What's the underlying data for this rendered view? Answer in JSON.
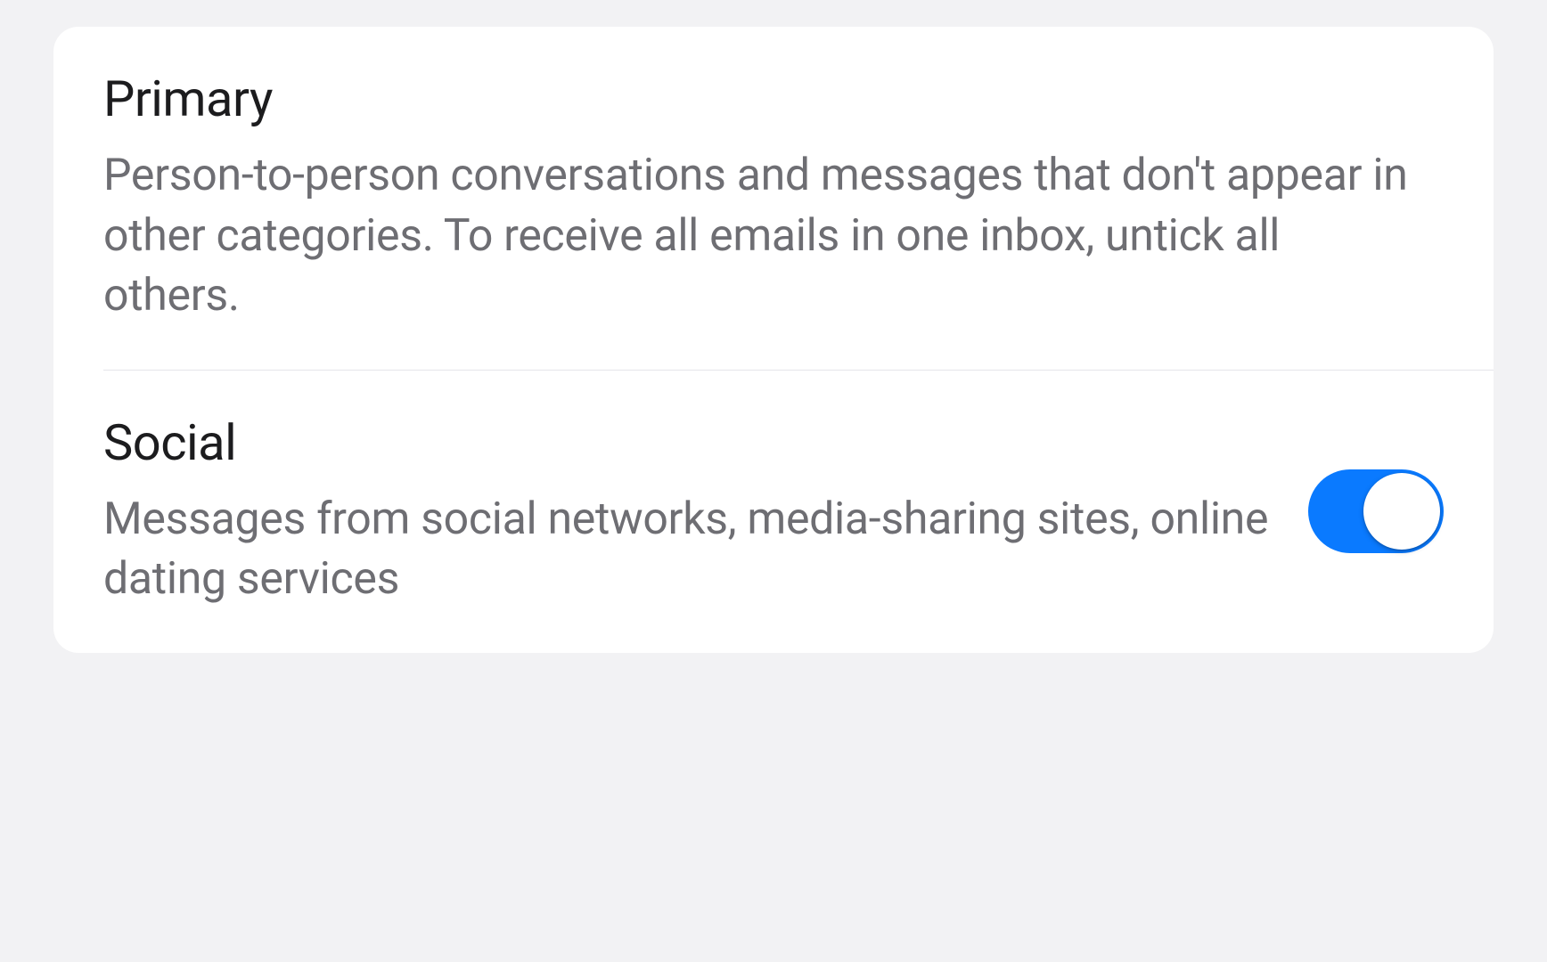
{
  "categories": [
    {
      "title": "Primary",
      "description": "Person-to-person conversations and messages that don't appear in other categories. To receive all emails in one inbox, untick all others.",
      "hasToggle": false,
      "toggleOn": false
    },
    {
      "title": "Social",
      "description": "Messages from social networks, media-sharing sites, online dating services",
      "hasToggle": true,
      "toggleOn": true
    }
  ]
}
